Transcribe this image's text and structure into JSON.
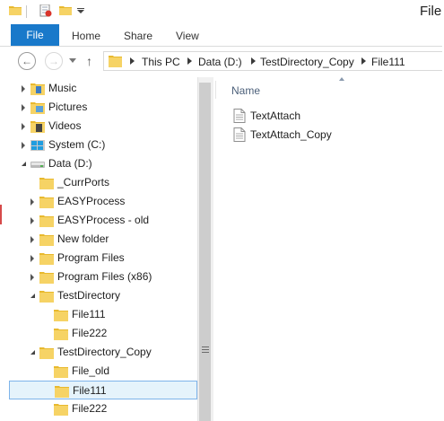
{
  "window": {
    "title": "File"
  },
  "ribbon": {
    "tabs": [
      {
        "label": "File"
      },
      {
        "label": "Home"
      },
      {
        "label": "Share"
      },
      {
        "label": "View"
      }
    ]
  },
  "address_bar": {
    "crumbs": [
      "This PC",
      "Data (D:)",
      "TestDirectory_Copy",
      "File111"
    ]
  },
  "nav_tree": [
    {
      "label": "Music",
      "icon": "music-folder-icon",
      "expander": "collapsed",
      "level": 0
    },
    {
      "label": "Pictures",
      "icon": "pictures-folder-icon",
      "expander": "collapsed",
      "level": 0
    },
    {
      "label": "Videos",
      "icon": "videos-folder-icon",
      "expander": "collapsed",
      "level": 0
    },
    {
      "label": "System (C:)",
      "icon": "system-drive-icon",
      "expander": "collapsed",
      "level": 0
    },
    {
      "label": "Data (D:)",
      "icon": "drive-icon",
      "expander": "expanded",
      "level": 0
    },
    {
      "label": "_CurrPorts",
      "icon": "folder-icon",
      "expander": "none",
      "level": 1
    },
    {
      "label": "EASYProcess",
      "icon": "folder-icon",
      "expander": "collapsed",
      "level": 1
    },
    {
      "label": "EASYProcess - old",
      "icon": "folder-icon",
      "expander": "collapsed",
      "level": 1
    },
    {
      "label": "New folder",
      "icon": "folder-icon",
      "expander": "collapsed",
      "level": 1
    },
    {
      "label": "Program Files",
      "icon": "folder-icon",
      "expander": "collapsed",
      "level": 1
    },
    {
      "label": "Program Files (x86)",
      "icon": "folder-icon",
      "expander": "collapsed",
      "level": 1
    },
    {
      "label": "TestDirectory",
      "icon": "folder-icon",
      "expander": "expanded",
      "level": 1
    },
    {
      "label": "File111",
      "icon": "folder-icon",
      "expander": "none",
      "level": 2
    },
    {
      "label": "File222",
      "icon": "folder-icon",
      "expander": "none",
      "level": 2
    },
    {
      "label": "TestDirectory_Copy",
      "icon": "folder-icon",
      "expander": "expanded",
      "level": 1
    },
    {
      "label": "File_old",
      "icon": "folder-icon",
      "expander": "none",
      "level": 2
    },
    {
      "label": "File111",
      "icon": "folder-icon",
      "expander": "none",
      "level": 2,
      "selected": true
    },
    {
      "label": "File222",
      "icon": "folder-icon",
      "expander": "none",
      "level": 2
    }
  ],
  "file_list": {
    "column_header": "Name",
    "items": [
      {
        "name": "TextAttach",
        "icon": "text-file-icon"
      },
      {
        "name": "TextAttach_Copy",
        "icon": "text-file-icon"
      }
    ]
  },
  "colors": {
    "file_tab": "#1979ca",
    "selection_bg": "#e5f3fb",
    "selection_border": "#7eb4ea",
    "folder_yellow": "#f0c94a"
  }
}
